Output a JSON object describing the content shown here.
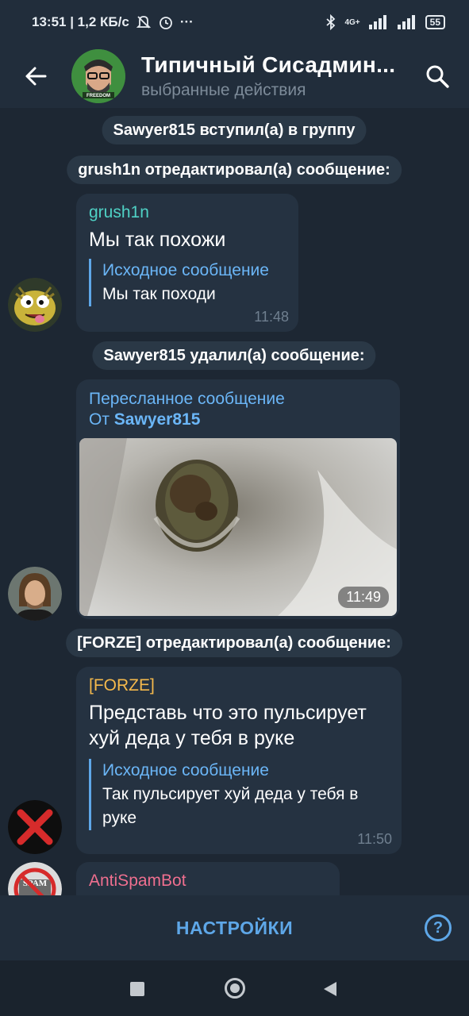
{
  "status_bar": {
    "time_speed": "13:51 | 1,2 КБ/с",
    "dots": "···",
    "network": "4G+",
    "battery": "55"
  },
  "header": {
    "title": "Типичный Сисадмин...",
    "subtitle": "выбранные действия",
    "avatar_caption": "FREEDOM"
  },
  "events": {
    "joined": "Sawyer815 вступил(а) в группу",
    "edited1": "grush1n отредактировал(а) сообщение:",
    "deleted": "Sawyer815 удалил(а) сообщение:",
    "edited2": "[FORZE] отредактировал(а) сообщение:"
  },
  "messages": {
    "m1": {
      "sender": "grush1n",
      "text": "Мы так похожи",
      "quote_title": "Исходное сообщение",
      "quote_text": "Мы так походи",
      "time": "11:48"
    },
    "m2": {
      "forward_title": "Пересланное сообщение",
      "forward_prefix": "От",
      "forward_from": "Sawyer815",
      "time": "11:49"
    },
    "m3": {
      "sender": "[FORZE]",
      "text_line1": "Представь что это пульсирует",
      "text_line2": "хуй деда у тебя в руке",
      "quote_title": "Исходное сообщение",
      "quote_line1": "Так пульсирует хуй деда у тебя в",
      "quote_line2": "руке",
      "time": "11:50"
    },
    "m4": {
      "sender": "AntiSpamBot",
      "avatar_label": "SPAM"
    }
  },
  "bottom_bar": {
    "settings_label": "НАСТРОЙКИ",
    "help_label": "?"
  },
  "colors": {
    "background": "#1d2733",
    "bar": "#212d3b",
    "bubble": "#253241",
    "accent": "#5ea7e8",
    "sender_grush1n": "#4fd1c5",
    "sender_forze": "#f5b94c",
    "sender_antispambot": "#ef6f8f"
  }
}
